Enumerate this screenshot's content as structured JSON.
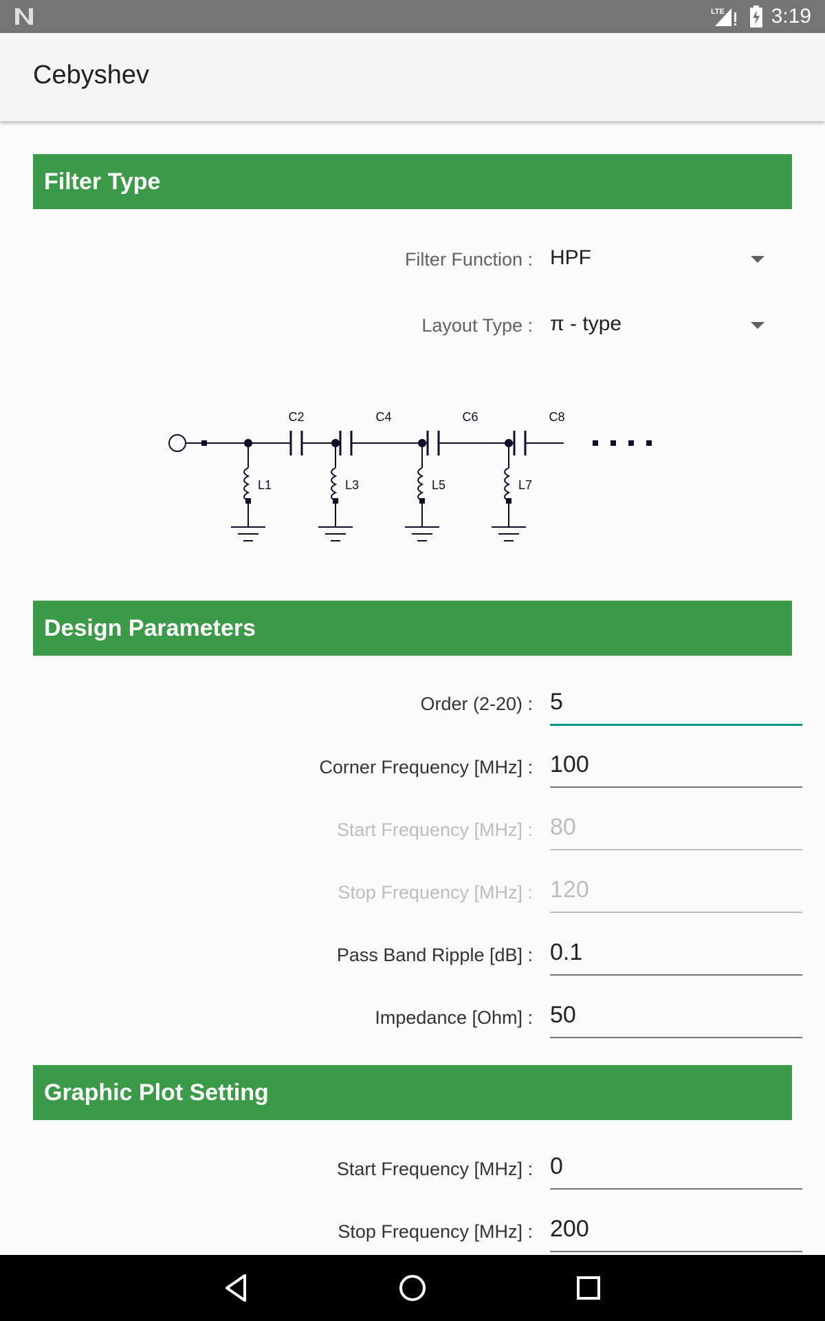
{
  "status_bar": {
    "time": "3:19",
    "network": "LTE",
    "icons": [
      "notification-n-icon",
      "lte-signal-icon",
      "battery-charging-icon"
    ]
  },
  "app_bar": {
    "title": "Cebyshev"
  },
  "filter_type": {
    "header": "Filter Type",
    "filter_function": {
      "label": "Filter Function :",
      "value": "HPF"
    },
    "layout_type": {
      "label": "Layout Type :",
      "value": "π - type"
    },
    "schematic": {
      "capacitors": [
        "C2",
        "C4",
        "C6",
        "C8"
      ],
      "inductors": [
        "L1",
        "L3",
        "L5",
        "L7"
      ]
    }
  },
  "design_parameters": {
    "header": "Design Parameters",
    "order": {
      "label": "Order (2-20) :",
      "value": "5"
    },
    "corner_frequency": {
      "label": "Corner Frequency [MHz] :",
      "value": "100"
    },
    "start_frequency": {
      "label": "Start Frequency [MHz] :",
      "value": "80"
    },
    "stop_frequency": {
      "label": "Stop Frequency [MHz] :",
      "value": "120"
    },
    "pass_band_ripple": {
      "label": "Pass Band Ripple [dB] :",
      "value": "0.1"
    },
    "impedance": {
      "label": "Impedance [Ohm] :",
      "value": "50"
    }
  },
  "graphic_plot_setting": {
    "header": "Graphic Plot Setting",
    "start_frequency": {
      "label": "Start Frequency [MHz] :",
      "value": "0"
    },
    "stop_frequency": {
      "label": "Stop Frequency [MHz] :",
      "value": "200"
    }
  },
  "nav_bar": {
    "icons": [
      "back-icon",
      "home-icon",
      "recents-icon"
    ]
  },
  "colors": {
    "section_header": "#3a9a47",
    "status_bar": "#757575",
    "accent": "#009688",
    "nav_bar": "#000000"
  }
}
